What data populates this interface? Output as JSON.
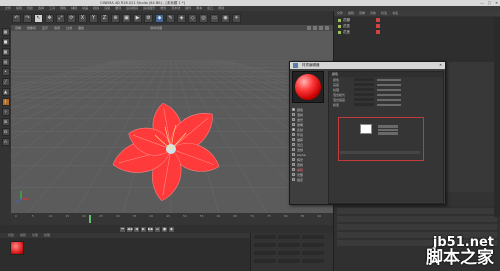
{
  "window": {
    "title": "CINEMA 4D R16.021 Studio (64 Bit) - [未标题 1 *]",
    "controls": [
      "—",
      "□",
      "✕"
    ]
  },
  "menubar": {
    "items": [
      "文件",
      "编辑",
      "创建",
      "选择",
      "工具",
      "网格",
      "捕捉",
      "动画",
      "模拟",
      "渲染",
      "雕刻",
      "运动跟踪",
      "运动图形",
      "角色",
      "流水线",
      "插件",
      "脚本",
      "窗口",
      "帮助"
    ]
  },
  "toolbar": {
    "icons": [
      {
        "name": "undo-icon",
        "glyph": "↶",
        "style": ""
      },
      {
        "name": "redo-icon",
        "glyph": "↷",
        "style": ""
      },
      {
        "name": "select-icon",
        "glyph": "↖",
        "style": "sel"
      },
      {
        "name": "move-icon",
        "glyph": "✥",
        "style": ""
      },
      {
        "name": "scale-icon",
        "glyph": "⤢",
        "style": ""
      },
      {
        "name": "rotate-icon",
        "glyph": "⟳",
        "style": ""
      },
      {
        "name": "x-axis-icon",
        "glyph": "X",
        "style": ""
      },
      {
        "name": "y-axis-icon",
        "glyph": "Y",
        "style": ""
      },
      {
        "name": "z-axis-icon",
        "glyph": "Z",
        "style": ""
      },
      {
        "name": "coord-system-icon",
        "glyph": "⊕",
        "style": ""
      },
      {
        "name": "render-view-icon",
        "glyph": "▣",
        "style": ""
      },
      {
        "name": "render-picture-viewer-icon",
        "glyph": "▶",
        "style": ""
      },
      {
        "name": "render-settings-icon",
        "glyph": "⚙",
        "style": ""
      },
      {
        "name": "cube-icon",
        "glyph": "◆",
        "style": "blue"
      },
      {
        "name": "pen-icon",
        "glyph": "✎",
        "style": ""
      },
      {
        "name": "subdivision-icon",
        "glyph": "◈",
        "style": ""
      },
      {
        "name": "array-icon",
        "glyph": "◇",
        "style": ""
      },
      {
        "name": "deformer-icon",
        "glyph": "◎",
        "style": ""
      },
      {
        "name": "floor-icon",
        "glyph": "▭",
        "style": ""
      },
      {
        "name": "camera-icon",
        "glyph": "◉",
        "style": ""
      },
      {
        "name": "light-icon",
        "glyph": "☀",
        "style": ""
      }
    ]
  },
  "lefttools": {
    "icons": [
      {
        "name": "make-editable-icon",
        "glyph": "▦",
        "style": ""
      },
      {
        "name": "model-mode-icon",
        "glyph": "■",
        "style": ""
      },
      {
        "name": "texture-mode-icon",
        "glyph": "▩",
        "style": ""
      },
      {
        "name": "workplane-icon",
        "glyph": "▤",
        "style": ""
      },
      {
        "name": "points-mode-icon",
        "glyph": "•",
        "style": ""
      },
      {
        "name": "edges-mode-icon",
        "glyph": "╱",
        "style": ""
      },
      {
        "name": "polygons-mode-icon",
        "glyph": "▲",
        "style": ""
      },
      {
        "name": "axis-icon",
        "glyph": "┼",
        "style": "orange"
      },
      {
        "name": "tweak-icon",
        "glyph": "✧",
        "style": ""
      },
      {
        "name": "snap-icon",
        "glyph": "⊞",
        "style": ""
      },
      {
        "name": "lock-workplane-icon",
        "glyph": "⊟",
        "style": ""
      },
      {
        "name": "magnet-icon",
        "glyph": "∩",
        "style": ""
      }
    ]
  },
  "viewport": {
    "menu": [
      "查看",
      "摄像机",
      "显示",
      "选项",
      "过滤",
      "面板"
    ],
    "label": "透视视图",
    "flower_color": "#ff3a3a",
    "grid_color": "#6a6a6a"
  },
  "timeline": {
    "ticks": [
      "0",
      "5",
      "10",
      "15",
      "20",
      "25",
      "30",
      "35",
      "40",
      "45",
      "50",
      "55",
      "60",
      "65",
      "70",
      "75",
      "80",
      "85",
      "90"
    ]
  },
  "playbar": {
    "buttons": [
      "⏮",
      "◀◀",
      "◀",
      "▶",
      "▶▶",
      "⏭",
      "●",
      "◆"
    ]
  },
  "material_manager": {
    "menu": [
      "创建",
      "编辑",
      "功能",
      "纹理"
    ],
    "material_color": "#e02020"
  },
  "object_manager": {
    "menu": [
      "文件",
      "编辑",
      "查看",
      "对象",
      "标签",
      "书签"
    ],
    "rows": [
      "花瓣",
      "花蕊",
      "花茎"
    ]
  },
  "material_editor": {
    "title": "材质编辑器",
    "close": "✕",
    "header": "颜色",
    "channels": [
      {
        "label": "颜色",
        "on": true,
        "hl": false
      },
      {
        "label": "漫射",
        "on": false,
        "hl": false
      },
      {
        "label": "发光",
        "on": false,
        "hl": false
      },
      {
        "label": "透明",
        "on": false,
        "hl": false
      },
      {
        "label": "反射",
        "on": true,
        "hl": false
      },
      {
        "label": "环境",
        "on": false,
        "hl": false
      },
      {
        "label": "烟雾",
        "on": false,
        "hl": false
      },
      {
        "label": "凹凸",
        "on": false,
        "hl": false
      },
      {
        "label": "法线",
        "on": false,
        "hl": false
      },
      {
        "label": "Alpha",
        "on": false,
        "hl": false
      },
      {
        "label": "辉光",
        "on": false,
        "hl": false
      },
      {
        "label": "置换",
        "on": false,
        "hl": false
      },
      {
        "label": "编辑",
        "on": false,
        "hl": true
      },
      {
        "label": "光照",
        "on": false,
        "hl": false
      },
      {
        "label": "指定",
        "on": false,
        "hl": false
      }
    ],
    "fields": [
      "颜色",
      "亮度",
      "纹理",
      "混合模式",
      "混合强度",
      "模型"
    ],
    "swatch_color": "#ffffff",
    "accent_color": "#c43a3a"
  },
  "watermark": {
    "line1": "jb51.net",
    "line2": "脚本之家"
  }
}
